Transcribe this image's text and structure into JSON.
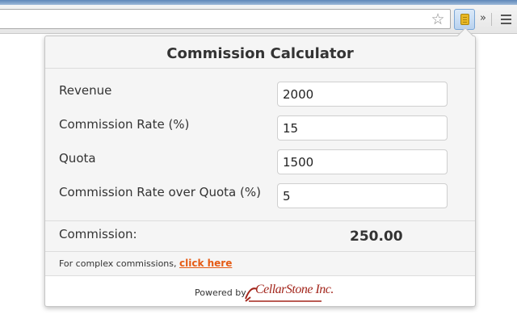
{
  "browser": {
    "star_icon": "star-icon",
    "extension_icon": "calculator-icon",
    "overflow_glyph": "»"
  },
  "popup": {
    "title": "Commission Calculator",
    "fields": [
      {
        "label": "Revenue",
        "value": "2000"
      },
      {
        "label": "Commission Rate (%)",
        "value": "15"
      },
      {
        "label": "Quota",
        "value": "1500"
      },
      {
        "label": "Commission Rate over Quota (%)",
        "value": "5"
      }
    ],
    "result": {
      "label": "Commission:",
      "value": "250.00"
    },
    "complex": {
      "text": "For complex commissions, ",
      "link": "click here"
    },
    "footer": {
      "powered_by": "Powered by",
      "logo_text": "CellarStone Inc."
    }
  },
  "colors": {
    "link": "#e55b15",
    "logo": "#a3261c",
    "extension_highlight": "#b9d2ee"
  }
}
